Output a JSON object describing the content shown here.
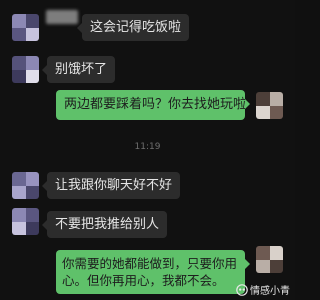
{
  "conversation": {
    "messages": [
      {
        "side": "in",
        "text": "这会记得吃饭啦"
      },
      {
        "side": "in",
        "text": "别饿坏了"
      },
      {
        "side": "out",
        "text": "两边都要踩着吗？你去找她玩啦"
      },
      {
        "side": "in",
        "text": "让我跟你聊天好不好"
      },
      {
        "side": "in",
        "text": "不要把我推给别人"
      },
      {
        "side": "out",
        "text": "你需要的她都能做到，只要你用心。但你再用心，我都不会。"
      }
    ],
    "timestamp": "11:19"
  },
  "watermark": {
    "text": "情感小青"
  },
  "colors": {
    "background": "#111111",
    "incoming_bubble": "#2c2c2c",
    "outgoing_bubble": "#5fc16a"
  }
}
